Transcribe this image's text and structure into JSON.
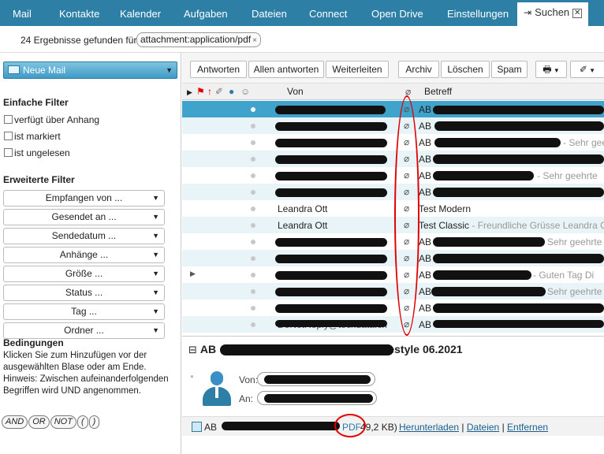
{
  "nav": {
    "tabs": [
      "Mail",
      "Kontakte",
      "Kalender",
      "Aufgaben",
      "Dateien",
      "Connect",
      "Open Drive",
      "Einstellungen"
    ],
    "active_tab": "Suchen",
    "close_glyph": "✕"
  },
  "results": {
    "count_text": "24 Ergebnisse gefunden für:",
    "query_chip": "attachment:application/pdf",
    "chip_close": "×"
  },
  "left": {
    "new_mail": "Neue Mail",
    "simple_filter_title": "Einfache Filter",
    "checkboxes": [
      "verfügt über Anhang",
      "ist markiert",
      "ist ungelesen"
    ],
    "advanced_filter_title": "Erweiterte Filter",
    "dropdowns": [
      "Empfangen von ...",
      "Gesendet an ...",
      "Sendedatum ...",
      "Anhänge ...",
      "Größe ...",
      "Status ...",
      "Tag ...",
      "Ordner ..."
    ],
    "conditions_title": "Bedingungen",
    "conditions_text": "Klicken Sie zum Hinzufügen vor der ausgewählten Blase oder am Ende. Hinweis: Zwischen aufeinanderfolgenden Begriffen wird UND angenommen.",
    "operators": [
      "AND",
      "OR",
      "NOT",
      "(",
      ")"
    ]
  },
  "toolbar": {
    "reply": "Antworten",
    "reply_all": "Allen antworten",
    "forward": "Weiterleiten",
    "archive": "Archiv",
    "delete": "Löschen",
    "spam": "Spam"
  },
  "list": {
    "col_from": "Von",
    "col_subject": "Betreff",
    "rows": [
      {
        "from": "",
        "subject": "AB",
        "snippet": ""
      },
      {
        "from": "",
        "subject": "AB",
        "snippet": ""
      },
      {
        "from": "",
        "subject": "AB",
        "snippet": "- Sehr gee"
      },
      {
        "from": "",
        "subject": "AB",
        "snippet": ""
      },
      {
        "from": "",
        "subject": "AB",
        "snippet": "- Sehr geehrte"
      },
      {
        "from": "",
        "subject": "AB",
        "snippet": ""
      },
      {
        "from": "Leandra Ott",
        "subject": "Test Modern",
        "snippet": ""
      },
      {
        "from": "Leandra Ott",
        "subject": "Test Classic",
        "snippet": "- Freundliche Grüsse Leandra Ott"
      },
      {
        "from": "",
        "subject": "AB",
        "snippet": "Sehr geehrte"
      },
      {
        "from": "",
        "subject": "AB",
        "snippet": ""
      },
      {
        "from": "",
        "subject": "AB",
        "snippet": "- Guten Tag Di"
      },
      {
        "from": "",
        "subject": "AB",
        "snippet": "Sehr geehrte"
      },
      {
        "from": "",
        "subject": "AB",
        "snippet": ""
      },
      {
        "from": "DoNotReply@techdata.ch",
        "subject": "AB",
        "snippet": ""
      }
    ]
  },
  "preview": {
    "subject": "AB",
    "subject_tail": "sting.westyle 06.2021",
    "from_label": "Von:",
    "to_label": "An:",
    "attachment": {
      "name": "AB",
      "type": "PDF",
      "size": "49,2 KB)",
      "download": "Herunterladen",
      "files": "Dateien",
      "remove": "Entfernen"
    }
  }
}
